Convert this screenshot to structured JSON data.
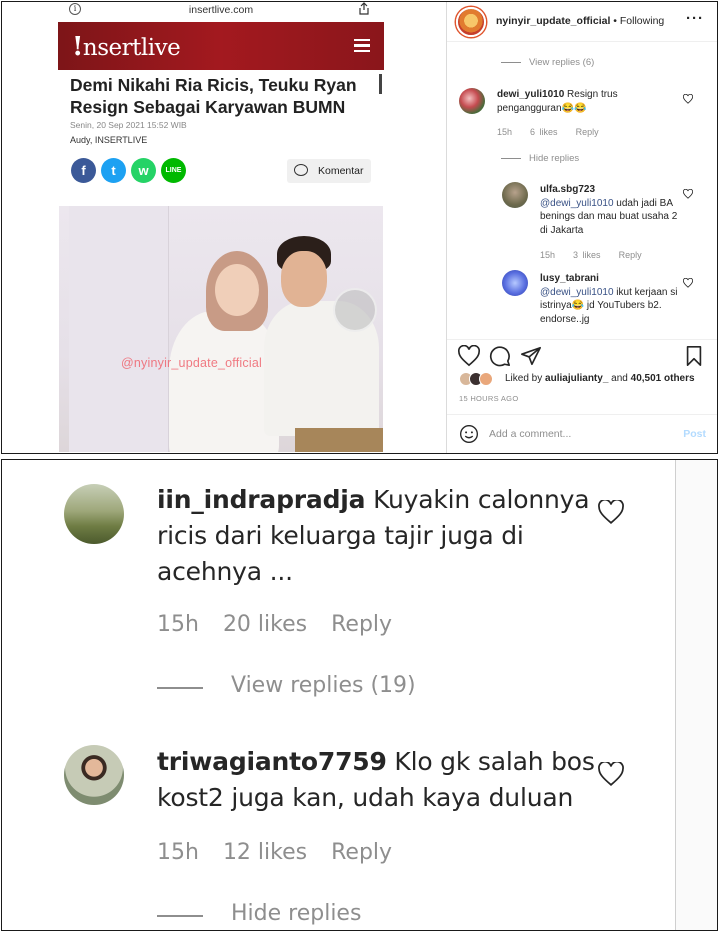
{
  "browser": {
    "url": "insertlive.com"
  },
  "site": {
    "logo_mark": "!",
    "logo_text": "nsertlive",
    "headline": "Demi Nikahi Ria Ricis, Teuku Ryan Resign Sebagai Karyawan BUMN",
    "dateline": "Senin, 20 Sep 2021 15:52 WIB",
    "byline": "Audy, INSERTLIVE",
    "share_buttons": [
      "f",
      "t",
      "w",
      "LINE"
    ],
    "komentar_label": "Komentar",
    "photo_watermark": "@nyinyir_update_official"
  },
  "instagram": {
    "account": "nyinyir_update_official",
    "follow_status": "• Following",
    "view_replies_top": "View replies (6)",
    "comments": [
      {
        "user": "dewi_yuli1010",
        "text": " Resign trus pengangguran😂😂",
        "time": "15h",
        "likes": "6 likes",
        "reply": "Reply"
      },
      {
        "user": "ulfa.sbg723",
        "mention": "@dewi_yuli1010",
        "text": " udah jadi BA benings dan mau buat usaha 2 di Jakarta",
        "time": "15h",
        "likes": "3 likes",
        "reply": "Reply"
      },
      {
        "user": "lusy_tabrani",
        "mention": "@dewi_yuli1010",
        "text": " ikut kerjaan si istrinya😂 jd YouTubers b2. endorse..jg"
      }
    ],
    "hide_replies": "Hide replies",
    "likes_prefix": "Liked by ",
    "liked_by_user": "auliajulianty_",
    "likes_and": " and ",
    "likes_count": "40,501 others",
    "time_ago": "15 HOURS AGO",
    "comment_placeholder": "Add a comment...",
    "post_label": "Post"
  },
  "zoomed_comments": [
    {
      "user": "iin_indrapradja",
      "text": " Kuyakin calonnya ricis dari keluarga tajir juga di acehnya ...",
      "time": "15h",
      "likes": "20 likes",
      "reply": "Reply",
      "replies_link": "View replies (19)"
    },
    {
      "user": "triwagianto7759",
      "text": " Klo gk salah bos kost2 juga kan, udah kaya duluan",
      "time": "15h",
      "likes": "12 likes",
      "reply": "Reply",
      "replies_link": "Hide replies"
    }
  ],
  "colors": {
    "brand_red": "#a3191f",
    "ig_link": "#385185",
    "muted": "#8e8e8e"
  },
  "icons": [
    "info-icon",
    "share-icon",
    "menu-icon",
    "chat-bubble-icon",
    "heart-icon",
    "comment-icon",
    "send-icon",
    "bookmark-icon",
    "emoji-icon",
    "more-icon"
  ]
}
